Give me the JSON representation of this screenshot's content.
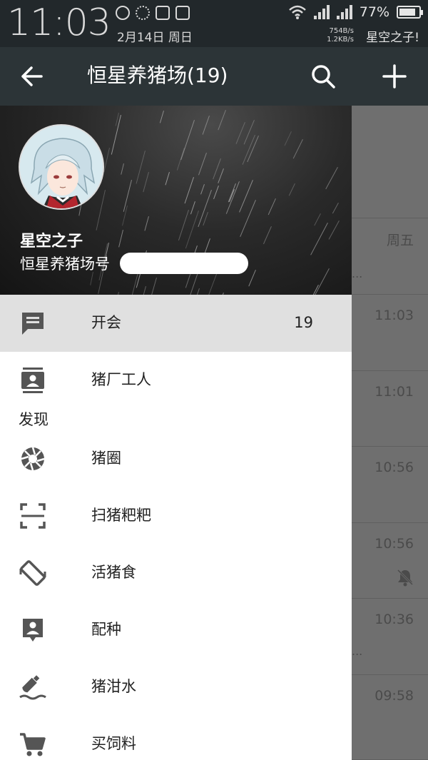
{
  "status_bar": {
    "time": "11:03",
    "date": "2月14日 周日",
    "battery": "77%",
    "battery_level": 0.77,
    "speed_down": "754B/s",
    "speed_up": "1.2KB/s",
    "carrier": "星空之子!"
  },
  "app_bar": {
    "title": "恒星养猪场(19)",
    "icons": [
      "arrow-back-icon",
      "search-icon",
      "plus-icon"
    ]
  },
  "chat_list": {
    "times": [
      "周五",
      "11:03",
      "11:01",
      "10:56",
      "10:56",
      "10:36",
      "09:58"
    ],
    "ellipsis": "..."
  },
  "drawer": {
    "profile": {
      "name": "星空之子",
      "id_label": "恒星养猪场号"
    },
    "items": [
      {
        "label": "开会",
        "badge": "19",
        "icon": "chat-icon"
      },
      {
        "label": "猪厂工人",
        "badge": "",
        "icon": "contacts-icon"
      }
    ],
    "section_discover": "发现",
    "discover_items": [
      {
        "label": "猪圈",
        "icon": "camera-aperture-icon"
      },
      {
        "label": "扫猪粑粑",
        "icon": "scan-icon"
      },
      {
        "label": "活猪食",
        "icon": "shake-phone-icon"
      },
      {
        "label": "配种",
        "icon": "person-nearby-icon"
      },
      {
        "label": "猪泔水",
        "icon": "drift-bottle-icon"
      },
      {
        "label": "买饲料",
        "icon": "cart-icon"
      }
    ]
  },
  "colors": {
    "status_bar_bg": "#22282b",
    "app_bar_bg": "#2c3437",
    "drawer_bg": "#ffffff",
    "active_item_bg": "#e0e0e0",
    "scrim": "#6f6f6f"
  }
}
